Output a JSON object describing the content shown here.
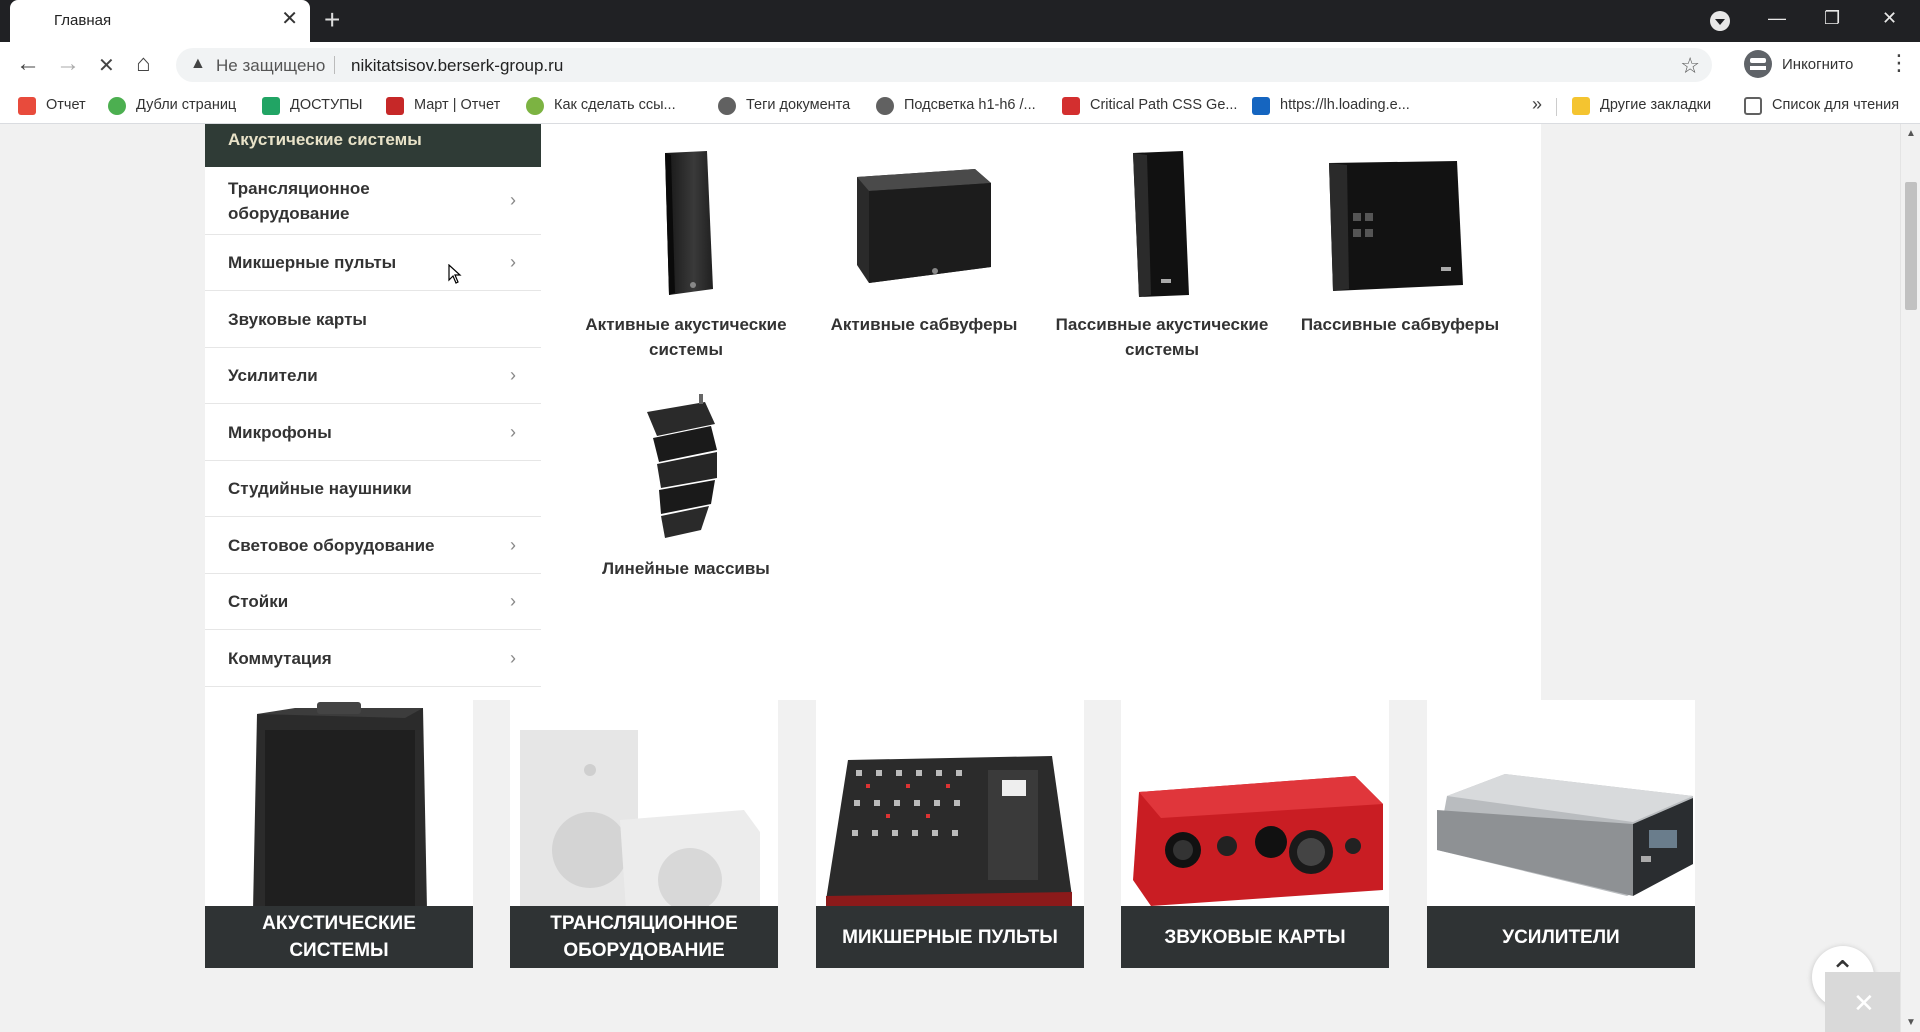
{
  "browser": {
    "tab_title": "Главная",
    "tab_close": "✕",
    "new_tab": "+",
    "nav_back": "←",
    "nav_forward": "→",
    "nav_stop": "✕",
    "nav_home": "⌂",
    "security_warning": "▲",
    "security_label": "Не защищено",
    "url": "nikitatsisov.berserk-group.ru",
    "bookmark_star": "☆",
    "incognito_label": "Инкогнито",
    "menu": "⋮",
    "win_minimize": "—",
    "win_restore": "❐",
    "win_close": "✕"
  },
  "bookmarks": {
    "items": [
      {
        "label": "Отчет",
        "color": "#e84b3c"
      },
      {
        "label": "Дубли страниц",
        "color": "#4caf50"
      },
      {
        "label": "ДОСТУПЫ",
        "color": "#21a464"
      },
      {
        "label": "Март | Отчет",
        "color": "#c62828"
      },
      {
        "label": "Как сделать ссы...",
        "color": "#7cb342"
      },
      {
        "label": "Теги документа",
        "color": "#616161"
      },
      {
        "label": "Подсветка h1-h6 /...",
        "color": "#616161"
      },
      {
        "label": "Critical Path CSS Ge...",
        "color": "#d32f2f"
      },
      {
        "label": "https://lh.loading.e...",
        "color": "#1565c0"
      }
    ],
    "more": "»",
    "other": {
      "label": "Другие закладки",
      "color": "#f4c430"
    },
    "reading_list": {
      "label": "Список для чтения",
      "color": "#616161"
    }
  },
  "sidebar": {
    "active": "Акустические системы",
    "items": [
      {
        "label": "Трансляционное оборудование",
        "chevron": true
      },
      {
        "label": "Микшерные пульты",
        "chevron": true
      },
      {
        "label": "Звуковые карты",
        "chevron": false
      },
      {
        "label": "Усилители",
        "chevron": true
      },
      {
        "label": "Микрофоны",
        "chevron": true
      },
      {
        "label": "Студийные наушники",
        "chevron": false
      },
      {
        "label": "Световое оборудование",
        "chevron": true
      },
      {
        "label": "Стойки",
        "chevron": true
      },
      {
        "label": "Коммутация",
        "chevron": true
      }
    ],
    "chevron_glyph": "›"
  },
  "subcategories": [
    {
      "name": "Активные акустические системы",
      "icon": "speaker-tall"
    },
    {
      "name": "Активные сабвуферы",
      "icon": "subwoofer"
    },
    {
      "name": "Пассивные акустические системы",
      "icon": "speaker-tall"
    },
    {
      "name": "Пассивные сабвуферы",
      "icon": "subwoofer"
    },
    {
      "name": "Линейные массивы",
      "icon": "line-array"
    }
  ],
  "categories": [
    {
      "name": "АКУСТИЧЕСКИЕ СИСТЕМЫ",
      "icon": "speaker"
    },
    {
      "name": "ТРАНСЛЯЦИОННОЕ ОБОРУДОВАНИЕ",
      "icon": "wall-speakers"
    },
    {
      "name": "МИКШЕРНЫЕ ПУЛЬТЫ",
      "icon": "mixer"
    },
    {
      "name": "ЗВУКОВЫЕ КАРТЫ",
      "icon": "audio-interface"
    },
    {
      "name": "УСИЛИТЕЛИ",
      "icon": "amplifier"
    }
  ],
  "scroll_top": "⌃",
  "close_widget": "✕",
  "colors": {
    "sidebar_active_bg": "#2f3b36",
    "sidebar_active_text": "#e8e2c8",
    "category_label_bg": "#2f3334"
  }
}
